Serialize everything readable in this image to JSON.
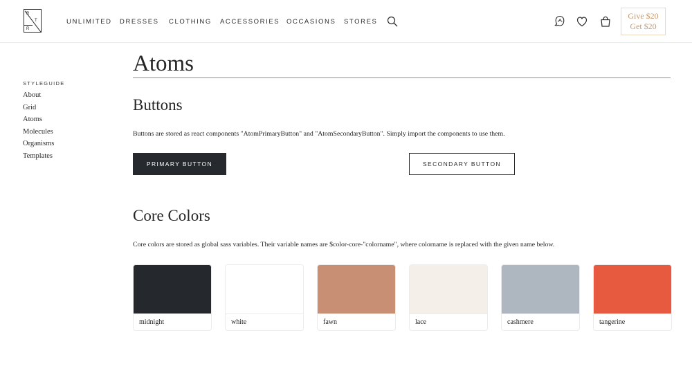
{
  "header": {
    "logo_letters": [
      "R",
      "T",
      "R"
    ],
    "nav": [
      "UNLIMITED",
      "DRESSES",
      "CLOTHING",
      "ACCESSORIES",
      "OCCASIONS",
      "STORES"
    ],
    "promo_line1": "Give $20",
    "promo_line2": "Get $20",
    "icons": [
      "search-icon",
      "stylist-icon",
      "heart-icon",
      "shopping-bag-icon"
    ]
  },
  "sidebar": {
    "title": "STYLEGUIDE",
    "items": [
      "About",
      "Grid",
      "Atoms",
      "Molecules",
      "Organisms",
      "Templates"
    ]
  },
  "main": {
    "title": "Atoms",
    "buttons_section": {
      "heading": "Buttons",
      "description": "Buttons are stored as react components \"AtomPrimaryButton\" and \"AtomSecondaryButton\". Simply import the components to use them.",
      "primary_label": "PRIMARY BUTTON",
      "secondary_label": "SECONDARY BUTTON"
    },
    "colors_section": {
      "heading": "Core Colors",
      "description": "Core colors are stored as global sass variables. Their variable names are $color-core-\"colorname\", where colorname is replaced with the given name below.",
      "swatches": [
        {
          "name": "midnight",
          "color": "#25282d"
        },
        {
          "name": "white",
          "color": "#ffffff"
        },
        {
          "name": "fawn",
          "color": "#c98f74"
        },
        {
          "name": "lace",
          "color": "#f5efea"
        },
        {
          "name": "cashmere",
          "color": "#aeb6bf"
        },
        {
          "name": "tangerine",
          "color": "#e85a40"
        }
      ]
    }
  },
  "colors": {
    "promo_text": "#c89b72",
    "promo_border": "#ecd9c4",
    "primary_button_bg": "#26292e"
  }
}
